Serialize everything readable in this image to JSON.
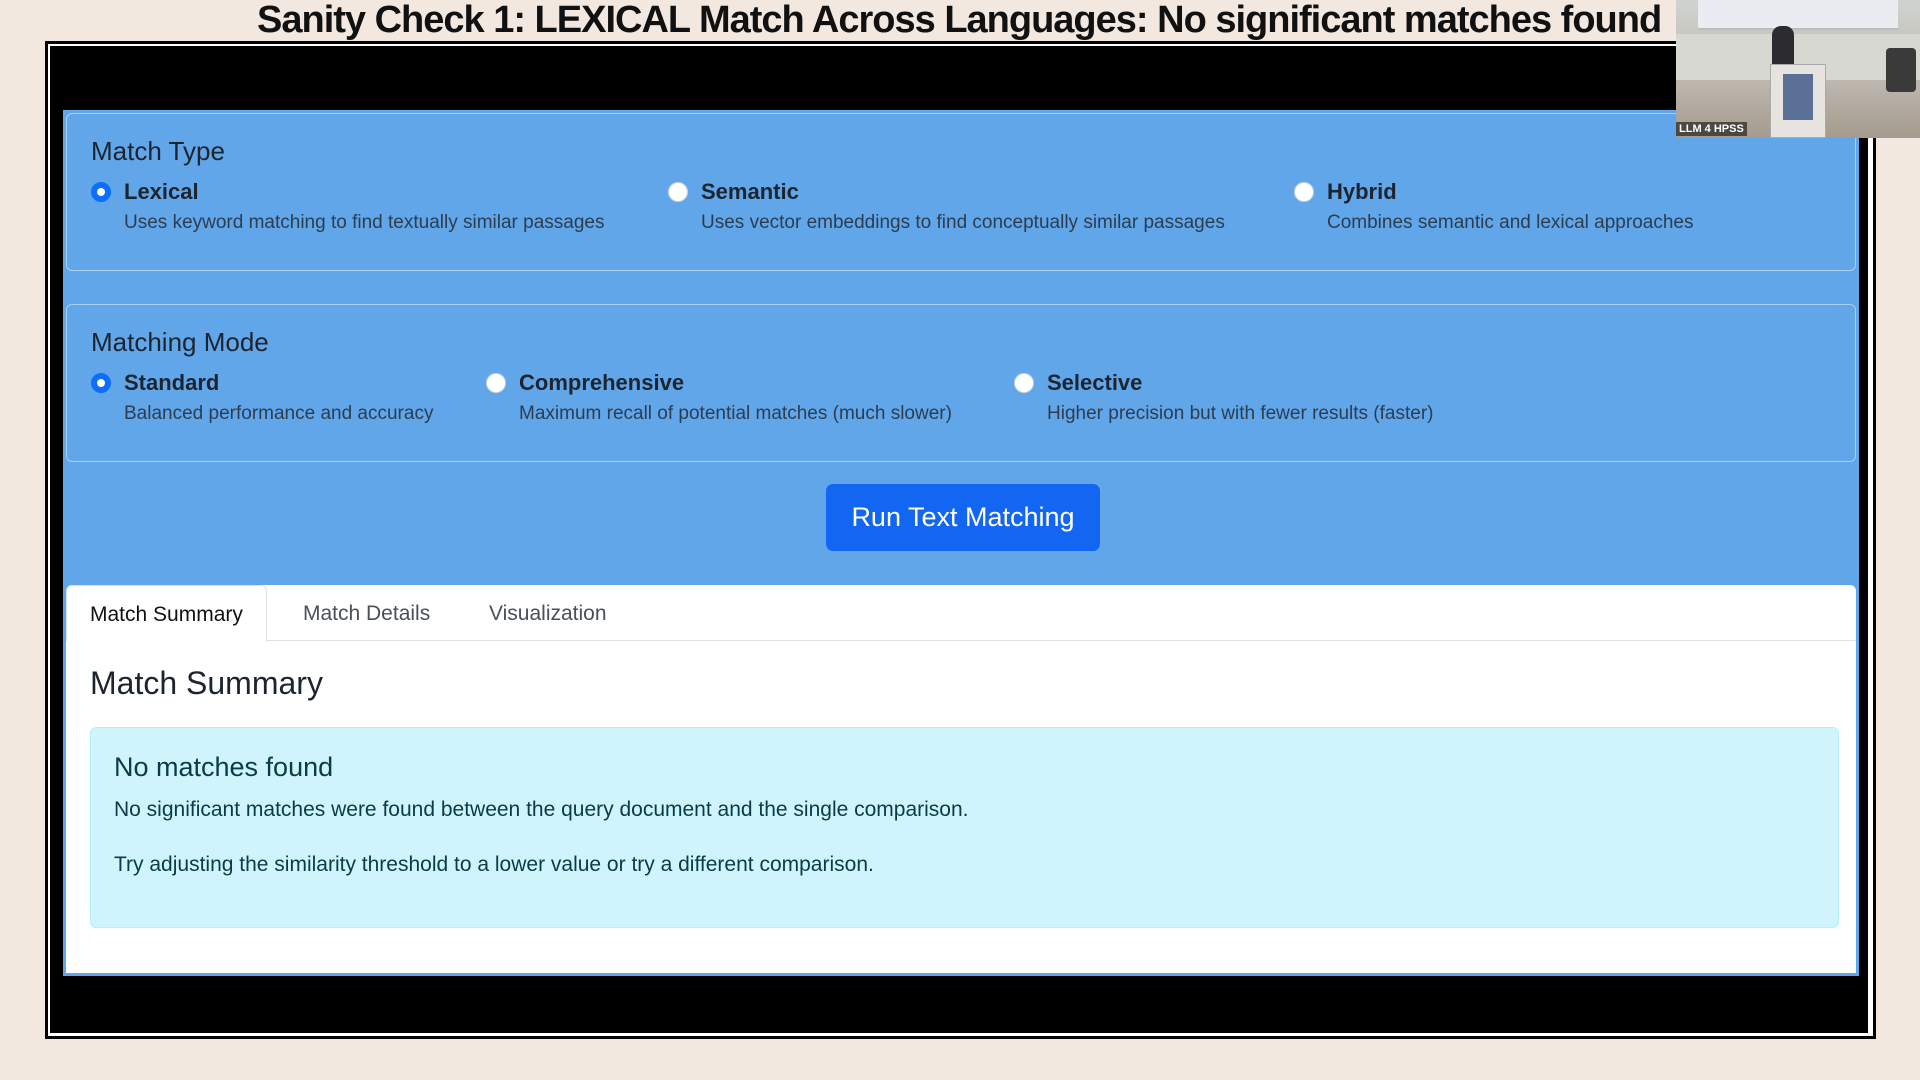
{
  "slide": {
    "title": "Sanity Check 1: LEXICAL Match Across Languages: No significant matches found"
  },
  "webcam": {
    "label": "LLM 4 HPSS"
  },
  "match_type": {
    "title": "Match Type",
    "selected": "Lexical",
    "options": [
      {
        "label": "Lexical",
        "description": "Uses keyword matching to find textually similar passages",
        "checked": true
      },
      {
        "label": "Semantic",
        "description": "Uses vector embeddings to find conceptually similar passages",
        "checked": false
      },
      {
        "label": "Hybrid",
        "description": "Combines semantic and lexical approaches",
        "checked": false
      }
    ]
  },
  "matching_mode": {
    "title": "Matching Mode",
    "selected": "Standard",
    "options": [
      {
        "label": "Standard",
        "description": "Balanced performance and accuracy",
        "checked": true
      },
      {
        "label": "Comprehensive",
        "description": "Maximum recall of potential matches (much slower)",
        "checked": false
      },
      {
        "label": "Selective",
        "description": "Higher precision but with fewer results (faster)",
        "checked": false
      }
    ]
  },
  "run_button": {
    "label": "Run Text Matching"
  },
  "tabs": [
    {
      "label": "Match Summary",
      "active": true
    },
    {
      "label": "Match Details",
      "active": false
    },
    {
      "label": "Visualization",
      "active": false
    }
  ],
  "summary": {
    "title": "Match Summary",
    "alert": {
      "title": "No matches found",
      "line1": "No significant matches were found between the query document and the single comparison.",
      "line2": "Try adjusting the similarity threshold to a lower value or try a different comparison."
    }
  },
  "colors": {
    "app_background": "#61a6e8",
    "primary_button": "#1266f1",
    "alert_background": "#cff4fc",
    "slide_background": "#f3e8df"
  }
}
